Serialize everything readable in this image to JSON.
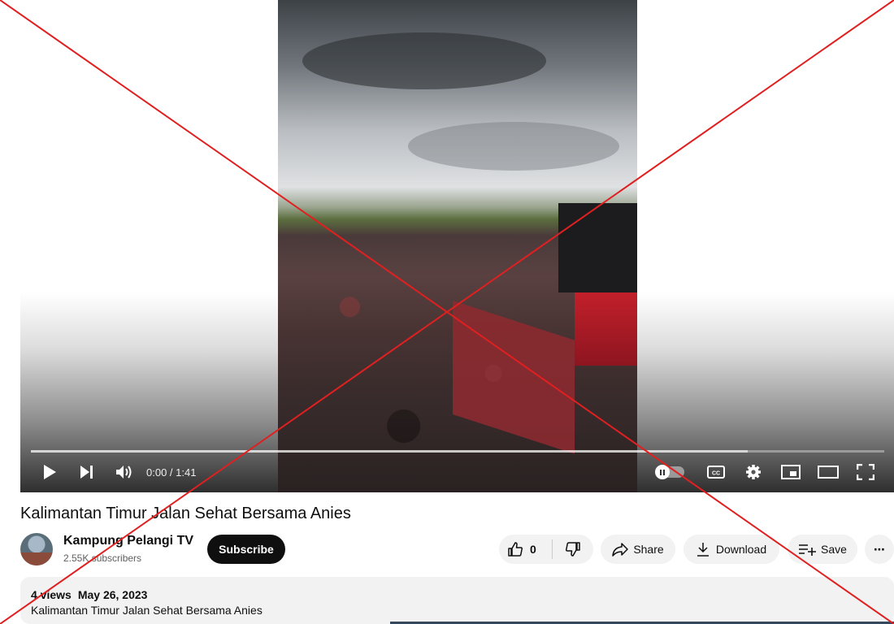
{
  "player": {
    "time_display": "0:00 / 1:41",
    "progress": 0.0,
    "buffered": 0.84
  },
  "video": {
    "title": "Kalimantan Timur Jalan Sehat Bersama Anies"
  },
  "channel": {
    "name": "Kampung Pelangi TV",
    "subscribers": "2.55K subscribers",
    "subscribe_label": "Subscribe"
  },
  "actions": {
    "like_count": "0",
    "share_label": "Share",
    "download_label": "Download",
    "save_label": "Save",
    "more_label": "⋯"
  },
  "description": {
    "views": "4 views",
    "date": "May 26, 2023",
    "text": "Kalimantan Timur Jalan Sehat Bersama Anies"
  },
  "colors": {
    "subscribe_bg": "#0f0f0f",
    "pill_bg": "#f2f2f2",
    "overlay_cross": "#e02020"
  },
  "icons": [
    "play-icon",
    "next-icon",
    "volume-icon",
    "autoplay-toggle-icon",
    "captions-icon",
    "settings-icon",
    "miniplayer-icon",
    "theater-icon",
    "fullscreen-icon",
    "like-icon",
    "dislike-icon",
    "share-icon",
    "download-icon",
    "save-icon",
    "more-icon"
  ]
}
